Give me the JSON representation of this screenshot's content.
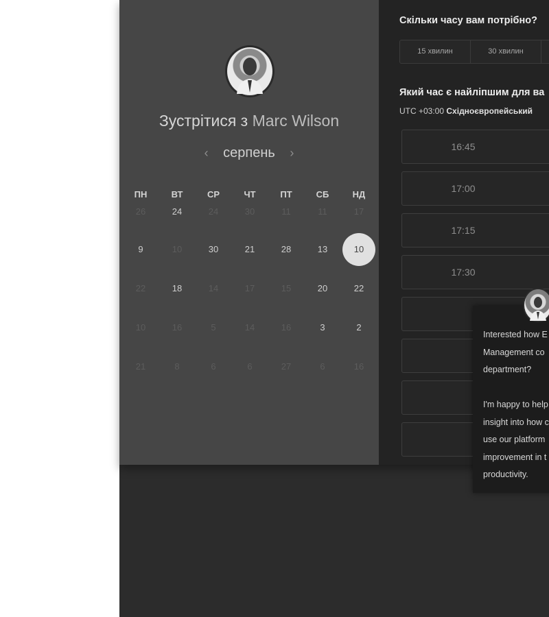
{
  "host": {
    "title_prefix": "Зустрітися з",
    "name": "Marc Wilson",
    "avatar_icon": "person-avatar"
  },
  "calendar": {
    "month": "серпень",
    "prev_icon": "‹",
    "next_icon": "›",
    "weekdays": [
      "ПН",
      "ВТ",
      "СР",
      "ЧТ",
      "ПТ",
      "СБ",
      "НД"
    ],
    "rows": [
      [
        {
          "d": "26",
          "s": "dim"
        },
        {
          "d": "24",
          "s": "active"
        },
        {
          "d": "24",
          "s": "dim"
        },
        {
          "d": "30",
          "s": "dim"
        },
        {
          "d": "11",
          "s": "dim"
        },
        {
          "d": "11",
          "s": "dim"
        },
        {
          "d": "17",
          "s": "dim"
        }
      ],
      [
        {
          "d": "9",
          "s": "active"
        },
        {
          "d": "10",
          "s": "dim"
        },
        {
          "d": "30",
          "s": "active"
        },
        {
          "d": "21",
          "s": "active"
        },
        {
          "d": "28",
          "s": "active"
        },
        {
          "d": "13",
          "s": "active"
        },
        {
          "d": "10",
          "s": "selected"
        }
      ],
      [
        {
          "d": "22",
          "s": "dim"
        },
        {
          "d": "18",
          "s": "active"
        },
        {
          "d": "14",
          "s": "dim"
        },
        {
          "d": "17",
          "s": "dim"
        },
        {
          "d": "15",
          "s": "dim"
        },
        {
          "d": "20",
          "s": "active"
        },
        {
          "d": "22",
          "s": "active"
        }
      ],
      [
        {
          "d": "10",
          "s": "dim"
        },
        {
          "d": "16",
          "s": "dim"
        },
        {
          "d": "5",
          "s": "dim"
        },
        {
          "d": "14",
          "s": "dim"
        },
        {
          "d": "16",
          "s": "dim"
        },
        {
          "d": "3",
          "s": "active"
        },
        {
          "d": "2",
          "s": "active"
        }
      ],
      [
        {
          "d": "21",
          "s": "dim"
        },
        {
          "d": "8",
          "s": "dim"
        },
        {
          "d": "6",
          "s": "dim"
        },
        {
          "d": "6",
          "s": "dim"
        },
        {
          "d": "27",
          "s": "dim"
        },
        {
          "d": "6",
          "s": "dim"
        },
        {
          "d": "16",
          "s": "dim"
        }
      ]
    ]
  },
  "duration": {
    "question": "Скільки часу вам потрібно?",
    "options": [
      "15 хвилин",
      "30 хвилин",
      ""
    ]
  },
  "time": {
    "question": "Який час є найліпшим для ва",
    "timezone_offset": "UTC +03:00",
    "timezone_name": "Східноєвропейський",
    "slots": [
      "16:45",
      "17:00",
      "17:15",
      "17:30",
      "",
      "",
      "",
      ""
    ]
  },
  "chat": {
    "avatar_icon": "person-avatar",
    "message": "Interested how E\nManagement co\ndepartment?\n\nI'm happy to help\ninsight into how c\nuse our platform\nimprovement in t\nproductivity."
  },
  "colors": {
    "left_panel": "#464646",
    "right_panel": "#232323",
    "selected_day": "#e0e0e0"
  }
}
